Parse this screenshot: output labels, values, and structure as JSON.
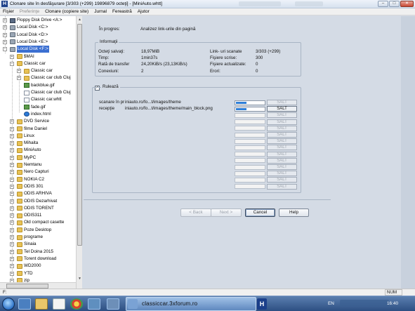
{
  "window": {
    "title": "Clonare site în desfăşurare [3/303 (+299) 19896879 octeţi] - [MiniAuto.whtt]",
    "app_icon": "H"
  },
  "menu": [
    "Fişier",
    "Preferinţe",
    "Clonare (copiere site)",
    "Jurnal",
    "Fereastră",
    "Ajutor"
  ],
  "menu_disabled": [
    false,
    true,
    false,
    false,
    false,
    false
  ],
  "tree": [
    {
      "label": "Floppy Disk Drive <A:>",
      "icon": "floppy-icon",
      "depth": 0,
      "exp": "+"
    },
    {
      "label": "Local Disk <C:>",
      "icon": "drive-icon",
      "depth": 0,
      "exp": "+"
    },
    {
      "label": "Local Disk <D:>",
      "icon": "drive-icon",
      "depth": 0,
      "exp": "+"
    },
    {
      "label": "Local Disk <E:>",
      "icon": "drive-icon",
      "depth": 0,
      "exp": "+"
    },
    {
      "label": "Local Disk <F:>",
      "icon": "drive-icon",
      "depth": 0,
      "exp": "−",
      "selected": true
    },
    {
      "label": "$MAI",
      "icon": "folder-icon",
      "depth": 1,
      "exp": "+"
    },
    {
      "label": "Classic car",
      "icon": "folder-icon",
      "depth": 1,
      "exp": "−"
    },
    {
      "label": "Classic car",
      "icon": "folder-icon",
      "depth": 2,
      "exp": "+"
    },
    {
      "label": "Classic car club Cluj",
      "icon": "folder-icon",
      "depth": 2,
      "exp": "+"
    },
    {
      "label": "backblue.gif",
      "icon": "gif-icon",
      "depth": 2,
      "exp": ""
    },
    {
      "label": "Classic car club Cluj",
      "icon": "file-icon",
      "depth": 2,
      "exp": ""
    },
    {
      "label": "Classic car.whtt",
      "icon": "file-icon",
      "depth": 2,
      "exp": ""
    },
    {
      "label": "fade.gif",
      "icon": "gif-icon",
      "depth": 2,
      "exp": ""
    },
    {
      "label": "index.html",
      "icon": "ie-icon",
      "depth": 2,
      "exp": ""
    },
    {
      "label": "DVD Service",
      "icon": "folder-icon",
      "depth": 1,
      "exp": "+"
    },
    {
      "label": "filme Daniel",
      "icon": "folder-icon",
      "depth": 1,
      "exp": "+"
    },
    {
      "label": "Linux",
      "icon": "folder-icon",
      "depth": 1,
      "exp": "+"
    },
    {
      "label": "Mihaita",
      "icon": "folder-icon",
      "depth": 1,
      "exp": "+"
    },
    {
      "label": "MiniAuto",
      "icon": "folder-icon",
      "depth": 1,
      "exp": "+"
    },
    {
      "label": "MyPC",
      "icon": "folder-icon",
      "depth": 1,
      "exp": "+"
    },
    {
      "label": "Nemtanu",
      "icon": "folder-icon",
      "depth": 1,
      "exp": "+"
    },
    {
      "label": "Nero Capturi",
      "icon": "folder-icon",
      "depth": 1,
      "exp": "+"
    },
    {
      "label": "NOKIA C2",
      "icon": "folder-icon",
      "depth": 1,
      "exp": "+"
    },
    {
      "label": "ODIS 301",
      "icon": "folder-icon",
      "depth": 1,
      "exp": "+"
    },
    {
      "label": "ODIS ARHIVA",
      "icon": "folder-icon",
      "depth": 1,
      "exp": "+"
    },
    {
      "label": "ODIS Dezarhivat",
      "icon": "folder-icon",
      "depth": 1,
      "exp": "+"
    },
    {
      "label": "ODIS TORENT",
      "icon": "folder-icon",
      "depth": 1,
      "exp": "+"
    },
    {
      "label": "ODIS311",
      "icon": "folder-icon",
      "depth": 1,
      "exp": "+"
    },
    {
      "label": "Old compact casette",
      "icon": "folder-icon",
      "depth": 1,
      "exp": "+"
    },
    {
      "label": "Poze Desktop",
      "icon": "folder-icon",
      "depth": 1,
      "exp": "+"
    },
    {
      "label": "programe",
      "icon": "folder-icon",
      "depth": 1,
      "exp": "+"
    },
    {
      "label": "Sinaia",
      "icon": "folder-icon",
      "depth": 1,
      "exp": "+"
    },
    {
      "label": "Tel Doina 2015",
      "icon": "folder-icon",
      "depth": 1,
      "exp": "+"
    },
    {
      "label": "Torent download",
      "icon": "folder-icon",
      "depth": 1,
      "exp": "+"
    },
    {
      "label": "WD2000",
      "icon": "folder-icon",
      "depth": 1,
      "exp": "+"
    },
    {
      "label": "YTD",
      "icon": "folder-icon",
      "depth": 1,
      "exp": "+"
    },
    {
      "label": "zip",
      "icon": "folder-icon",
      "depth": 1,
      "exp": "+"
    }
  ],
  "progress": {
    "label": "În progres:",
    "value": "Analizez link-urile din pagină"
  },
  "info": {
    "title": "Informaţii",
    "left": [
      {
        "label": "Octeţi salvaţi:",
        "value": "18,97MiB"
      },
      {
        "label": "Timp:",
        "value": "1min37s"
      },
      {
        "label": "Rată de transfer",
        "value": "24,20KiB/s (23,13KiB/s)"
      },
      {
        "label": "Conexiuni:",
        "value": "2"
      }
    ],
    "right": [
      {
        "label": "Link- uri scanate",
        "value": "3/303 (+299)"
      },
      {
        "label": "Fişiere scrise:",
        "value": "300"
      },
      {
        "label": "Fişiere actualizate:",
        "value": "0"
      },
      {
        "label": "Erori:",
        "value": "0"
      }
    ]
  },
  "run_checkbox": {
    "label": "Rulează",
    "checked": true,
    "check_glyph": "✓"
  },
  "transfers": [
    {
      "label": "scanare în pr",
      "url": "iniauto.ro/fo...t/images/theme",
      "progress": 0.35,
      "salt": "SALT",
      "enabled": false
    },
    {
      "label": "recepţie",
      "url": "iniauto.ro/fo...t/images/theme/main_block.png",
      "progress": 0.35,
      "salt": "SALT",
      "enabled": true
    },
    {
      "label": "",
      "url": "",
      "progress": 0,
      "salt": "SALT",
      "enabled": false
    },
    {
      "label": "",
      "url": "",
      "progress": 0,
      "salt": "SALT",
      "enabled": false
    },
    {
      "label": "",
      "url": "",
      "progress": 0,
      "salt": "SALT",
      "enabled": false
    },
    {
      "label": "",
      "url": "",
      "progress": 0,
      "salt": "SALT",
      "enabled": false
    },
    {
      "label": "",
      "url": "",
      "progress": 0,
      "salt": "SALT",
      "enabled": false
    },
    {
      "label": "",
      "url": "",
      "progress": 0,
      "salt": "SALT",
      "enabled": false
    },
    {
      "label": "",
      "url": "",
      "progress": 0,
      "salt": "SALT",
      "enabled": false
    },
    {
      "label": "",
      "url": "",
      "progress": 0,
      "salt": "SALT",
      "enabled": false
    },
    {
      "label": "",
      "url": "",
      "progress": 0,
      "salt": "SALT",
      "enabled": false
    },
    {
      "label": "",
      "url": "",
      "progress": 0,
      "salt": "SALT",
      "enabled": false
    },
    {
      "label": "",
      "url": "",
      "progress": 0,
      "salt": "SALT",
      "enabled": false
    },
    {
      "label": "",
      "url": "",
      "progress": 0,
      "salt": "SALT",
      "enabled": false
    }
  ],
  "buttons": {
    "back": "< Back",
    "next": "Next >",
    "cancel": "Cancel",
    "help": "Help"
  },
  "status": {
    "left": "F:",
    "num": "NUM"
  },
  "taskbar": {
    "active_label": "classiccar.3xforum.ro",
    "language": "EN",
    "clock": "16:40"
  },
  "window_buttons": {
    "minimize": "–",
    "maximize": "□",
    "close": "✕"
  },
  "colors": {
    "accent": "#2f7fd8",
    "selection": "#3b6fd1",
    "taskbar": "#2d4f82"
  }
}
